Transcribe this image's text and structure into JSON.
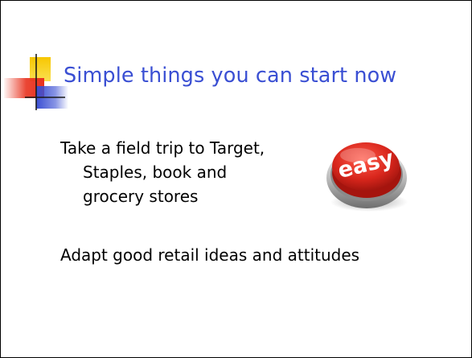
{
  "slide": {
    "title": "Simple things you can start now",
    "bullets": [
      {
        "lines": [
          "Take a field trip to Target,",
          "Staples, book and",
          "grocery stores"
        ]
      },
      {
        "lines": [
          "Adapt good retail ideas and attitudes"
        ]
      }
    ],
    "easy_button": {
      "label": "easy"
    }
  },
  "colors": {
    "title": "#3a4fd3",
    "accent_yellow": "#f7c600",
    "accent_red": "#e8321e",
    "accent_blue": "#3a4fd3",
    "button_red": "#d8261c"
  }
}
